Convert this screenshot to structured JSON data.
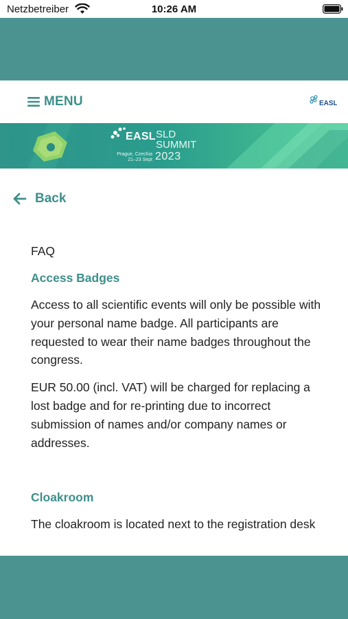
{
  "status_bar": {
    "carrier": "Netzbetreiber",
    "time": "10:26 AM",
    "wifi_icon": "wifi-icon",
    "battery_icon": "battery-icon"
  },
  "header": {
    "menu_label": "MENU",
    "menu_icon": "hamburger-icon",
    "logo_text": "EASL"
  },
  "banner": {
    "brand": "EASL",
    "line1": "SLD",
    "line2": "SUMMIT",
    "place": "Prague, Czechia",
    "dates": "21–23 Sept",
    "year": "2023"
  },
  "back": {
    "label": "Back",
    "icon": "arrow-left-icon"
  },
  "faq": {
    "title": "FAQ",
    "sections": [
      {
        "heading": "Access Badges",
        "paragraphs": [
          "Access to all scientific events will only be possible with your personal name badge. All participants are requested to wear their name badges throughout the congress.",
          "EUR 50.00 (incl. VAT) will be charged for replacing a lost badge and for re-printing due to incorrect submission of names and/or company names or addresses."
        ]
      },
      {
        "heading": "Cloakroom",
        "paragraphs": [
          "The cloakroom is located next to the registration desk"
        ]
      }
    ]
  },
  "colors": {
    "teal_band": "#4a9390",
    "accent": "#3e8f8b",
    "text": "#222222"
  }
}
